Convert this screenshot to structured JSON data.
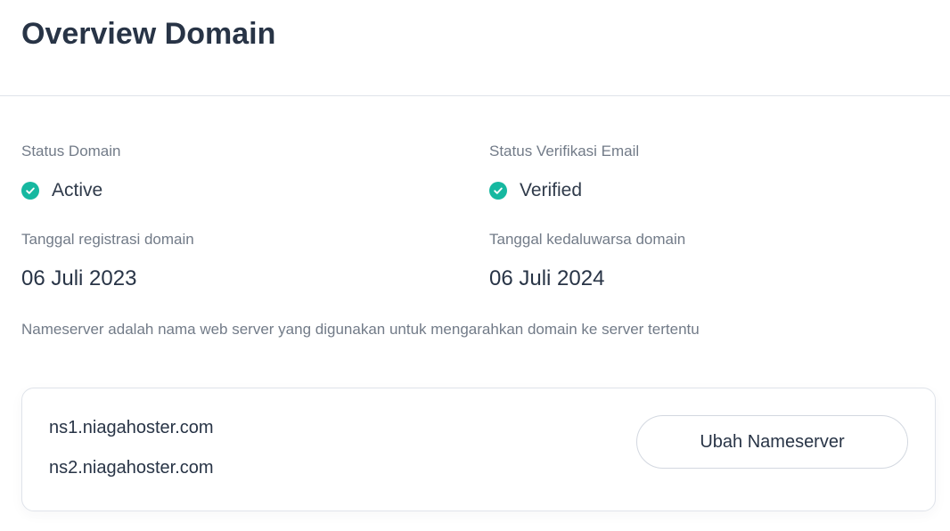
{
  "header": {
    "title": "Overview Domain"
  },
  "status": {
    "domain": {
      "label": "Status Domain",
      "value": "Active",
      "icon": "check-circle-icon"
    },
    "email_verification": {
      "label": "Status Verifikasi Email",
      "value": "Verified",
      "icon": "check-circle-icon"
    }
  },
  "dates": {
    "registration": {
      "label": "Tanggal registrasi domain",
      "value": "06 Juli 2023"
    },
    "expiration": {
      "label": "Tanggal kedaluwarsa domain",
      "value": "06 Juli 2024"
    }
  },
  "nameserver": {
    "description": "Nameserver adalah nama web server yang digunakan untuk mengarahkan domain ke server tertentu",
    "servers": [
      "ns1.niagahoster.com",
      "ns2.niagahoster.com"
    ],
    "change_button_label": "Ubah Nameserver"
  },
  "colors": {
    "accent_success": "#16b8a0",
    "text_primary": "#283446",
    "text_muted": "#727b88",
    "border": "#dfe3ea"
  }
}
